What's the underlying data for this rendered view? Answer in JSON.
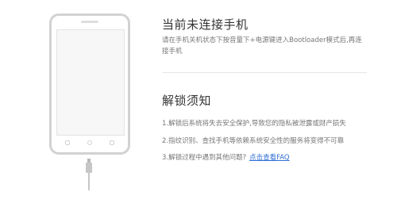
{
  "phone_illustration": {
    "icon": "phone-with-usb-cable-icon"
  },
  "status": {
    "title": "当前未连接手机",
    "description": "请在手机关机状态下按音量下+电源键进入Bootloader模式后,再连接手机"
  },
  "notice": {
    "title": "解锁须知",
    "items": [
      "1.解锁后系统将失去安全保护,导致您的隐私被泄露或财产损失",
      "2.指纹识别、查找手机等依赖系统安全性的服务将变得不可靠",
      "3.解锁过程中遇到其他问题?"
    ],
    "faq_link": "点击查看FAQ"
  },
  "colors": {
    "link": "#2f6fd3",
    "title": "#333333",
    "body": "#777777"
  }
}
